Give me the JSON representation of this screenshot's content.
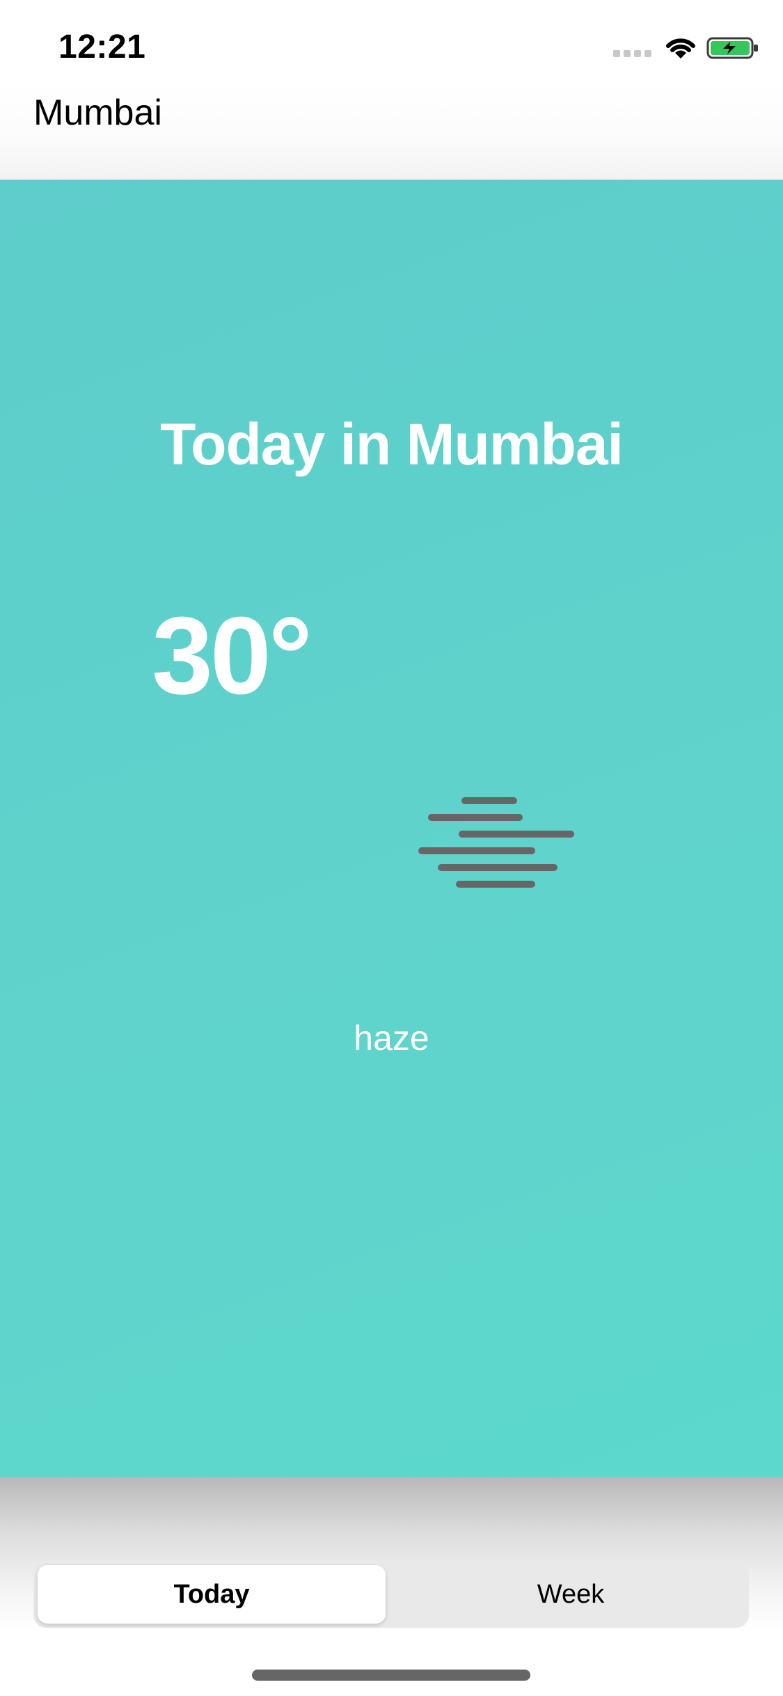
{
  "status_bar": {
    "time": "12:21"
  },
  "nav": {
    "title": "Mumbai"
  },
  "weather": {
    "title": "Today in Mumbai",
    "temperature": "30°",
    "condition": "haze",
    "icon": "haze-icon"
  },
  "segmented_control": {
    "selected": "Today",
    "options": [
      "Today",
      "Week"
    ]
  },
  "colors": {
    "card_bg": "#5fd2cc",
    "text_on_card": "#ffffff",
    "haze_lines": "#666666"
  }
}
